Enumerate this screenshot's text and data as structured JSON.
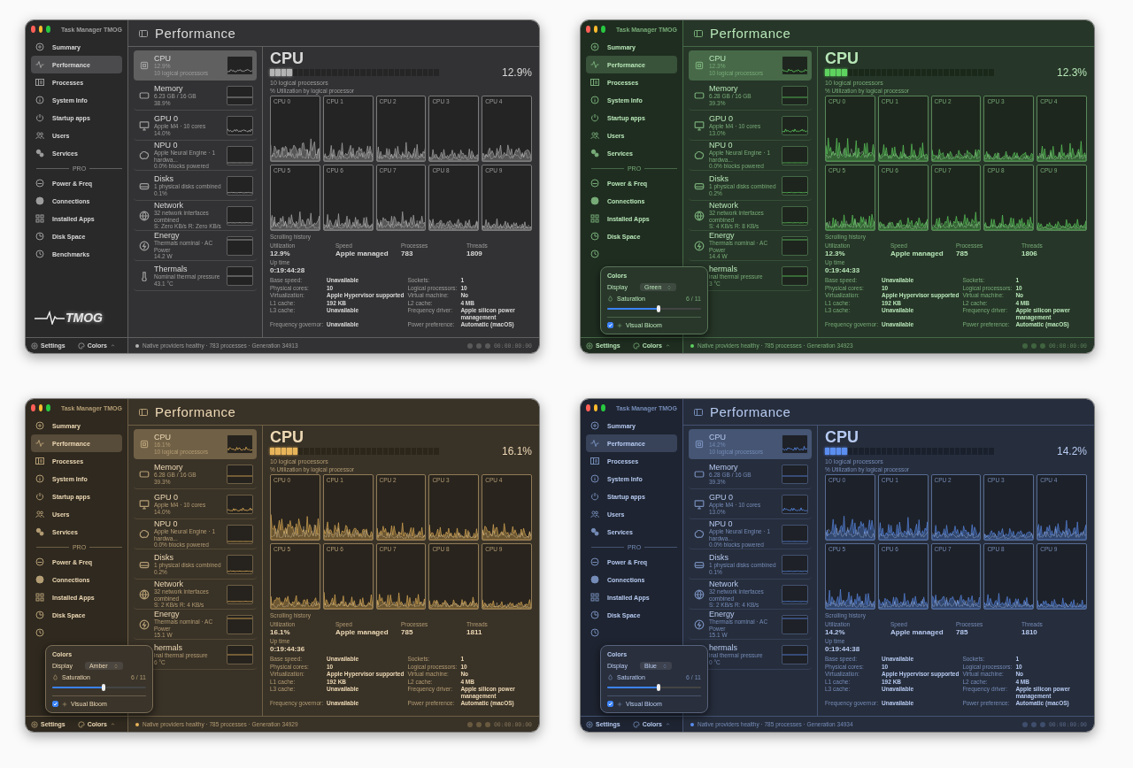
{
  "windows": [
    {
      "color": "#b4b4b4",
      "app_title": "Task Manager TMOG",
      "page_title": "Performance",
      "logo": "TMOG",
      "sidebar": {
        "items": [
          {
            "label": "Summary",
            "selected": false
          },
          {
            "label": "Performance",
            "selected": true
          },
          {
            "label": "Processes",
            "selected": false
          },
          {
            "label": "System Info",
            "selected": false
          },
          {
            "label": "Startup apps",
            "selected": false
          },
          {
            "label": "Users",
            "selected": false
          },
          {
            "label": "Services",
            "selected": false
          }
        ],
        "section_label": "PRO",
        "pro_items": [
          {
            "label": "Power & Freq",
            "selected": false
          },
          {
            "label": "Connections",
            "selected": false
          },
          {
            "label": "Installed Apps",
            "selected": false
          },
          {
            "label": "Disk Space",
            "selected": false
          },
          {
            "label": "Benchmarks",
            "selected": false
          }
        ]
      },
      "devices": [
        {
          "kind": "cpu",
          "name": "CPU",
          "line1": "12.9%",
          "line2": "10 logical processors",
          "selected": true
        },
        {
          "kind": "memory",
          "name": "Memory",
          "line1": "6.23 GB / 16 GB",
          "line2": "38.9%",
          "selected": false
        },
        {
          "kind": "gpu",
          "name": "GPU 0",
          "line1": "Apple M4 · 10 cores",
          "line2": "14.0%",
          "selected": false
        },
        {
          "kind": "npu",
          "name": "NPU 0",
          "line1": "Apple Neural Engine · 1 hardwa...",
          "line2": "0.0% blocks powered",
          "selected": false
        },
        {
          "kind": "disk",
          "name": "Disks",
          "line1": "1 physical disks combined",
          "line2": "0.1%",
          "selected": false
        },
        {
          "kind": "network",
          "name": "Network",
          "line1": "32 network interfaces combined",
          "line2": "S: Zero KB/s  R: Zero KB/s",
          "selected": false
        },
        {
          "kind": "energy",
          "name": "Energy",
          "line1": "Thermals nominal · AC Power",
          "line2": "14.2 W",
          "selected": false
        },
        {
          "kind": "thermal",
          "name": "Thermals",
          "line1": "Nominal thermal pressure",
          "line2": "43.1 °C",
          "selected": false
        }
      ],
      "detail": {
        "title": "CPU",
        "meter": {
          "level": 0.129
        },
        "reading": "12.9%",
        "subtitle": "10 logical processors",
        "caption": "% Utilization by logical processor",
        "graphs": [
          "CPU 0",
          "CPU 1",
          "CPU 2",
          "CPU 3",
          "CPU 4",
          "CPU 5",
          "CPU 6",
          "CPU 7",
          "CPU 8",
          "CPU 9"
        ],
        "history_label": "Scrolling history",
        "stats": [
          {
            "label": "Utilization",
            "value": "12.9%"
          },
          {
            "label": "Speed",
            "value": "Apple managed"
          },
          {
            "label": "Processes",
            "value": "783"
          },
          {
            "label": "Threads",
            "value": "1809"
          }
        ],
        "uptime": {
          "label": "Up time",
          "value": "0:19:44:28"
        },
        "specs": [
          {
            "label": "Base speed:",
            "value": "Unavailable"
          },
          {
            "label": "Sockets:",
            "value": "1"
          },
          {
            "label": "Physical cores:",
            "value": "10"
          },
          {
            "label": "Logical processors:",
            "value": "10"
          },
          {
            "label": "Virtualization:",
            "value": "Apple Hypervisor supported"
          },
          {
            "label": "Virtual machine:",
            "value": "No"
          },
          {
            "label": "L1 cache:",
            "value": "192 KB"
          },
          {
            "label": "L2 cache:",
            "value": "4 MB"
          },
          {
            "label": "L3 cache:",
            "value": "Unavailable"
          },
          {
            "label": "Frequency driver:",
            "value": "Apple silicon power management"
          },
          {
            "label": "Frequency governor:",
            "value": "Unavailable"
          },
          {
            "label": "Power preference:",
            "value": "Automatic (macOS)"
          }
        ]
      },
      "footer": {
        "settings": "Settings",
        "colors": "Colors",
        "status": "Native providers healthy · 783 processes · Generation 34913",
        "timer": "00:00:00:00"
      }
    },
    {
      "color": "#5fd35f",
      "app_title": "Task Manager TMOG",
      "page_title": "Performance",
      "sidebar": {
        "items": [
          {
            "label": "Summary",
            "selected": false
          },
          {
            "label": "Performance",
            "selected": true
          },
          {
            "label": "Processes",
            "selected": false
          },
          {
            "label": "System Info",
            "selected": false
          },
          {
            "label": "Startup apps",
            "selected": false
          },
          {
            "label": "Users",
            "selected": false
          },
          {
            "label": "Services",
            "selected": false
          }
        ],
        "section_label": "PRO",
        "pro_items": [
          {
            "label": "Power & Freq",
            "selected": false
          },
          {
            "label": "Connections",
            "selected": false
          },
          {
            "label": "Installed Apps",
            "selected": false
          },
          {
            "label": "Disk Space",
            "selected": false
          },
          {
            "selected": false
          }
        ]
      },
      "devices": [
        {
          "kind": "cpu",
          "name": "CPU",
          "line1": "12.3%",
          "line2": "10 logical processors",
          "selected": true
        },
        {
          "kind": "memory",
          "name": "Memory",
          "line1": "6.28 GB / 16 GB",
          "line2": "39.3%",
          "selected": false
        },
        {
          "kind": "gpu",
          "name": "GPU 0",
          "line1": "Apple M4 · 10 cores",
          "line2": "13.0%",
          "selected": false
        },
        {
          "kind": "npu",
          "name": "NPU 0",
          "line1": "Apple Neural Engine · 1 hardwa...",
          "line2": "0.0% blocks powered",
          "selected": false
        },
        {
          "kind": "disk",
          "name": "Disks",
          "line1": "1 physical disks combined",
          "line2": "0.2%",
          "selected": false
        },
        {
          "kind": "network",
          "name": "Network",
          "line1": "32 network interfaces combined",
          "line2": "S: 4 KB/s  R: 8 KB/s",
          "selected": false
        },
        {
          "kind": "energy",
          "name": "Energy",
          "line1": "Thermals nominal · AC Power",
          "line2": "14.4 W",
          "selected": false
        },
        {
          "name": "hermals",
          "line1": "inal thermal pressure",
          "line2": "3 °C",
          "selected": false
        }
      ],
      "detail": {
        "title": "CPU",
        "meter": {
          "level": 0.123
        },
        "reading": "12.3%",
        "subtitle": "10 logical processors",
        "caption": "% Utilization by logical processor",
        "graphs": [
          "CPU 0",
          "CPU 1",
          "CPU 2",
          "CPU 3",
          "CPU 4",
          "CPU 5",
          "CPU 6",
          "CPU 7",
          "CPU 8",
          "CPU 9"
        ],
        "history_label": "Scrolling history",
        "stats": [
          {
            "label": "Utilization",
            "value": "12.3%"
          },
          {
            "label": "Speed",
            "value": "Apple managed"
          },
          {
            "label": "Processes",
            "value": "785"
          },
          {
            "label": "Threads",
            "value": "1806"
          }
        ],
        "uptime": {
          "label": "Up time",
          "value": "0:19:44:33"
        },
        "specs": [
          {
            "label": "Base speed:",
            "value": "Unavailable"
          },
          {
            "label": "Sockets:",
            "value": "1"
          },
          {
            "label": "Physical cores:",
            "value": "10"
          },
          {
            "label": "Logical processors:",
            "value": "10"
          },
          {
            "label": "Virtualization:",
            "value": "Apple Hypervisor supported"
          },
          {
            "label": "Virtual machine:",
            "value": "No"
          },
          {
            "label": "L1 cache:",
            "value": "192 KB"
          },
          {
            "label": "L2 cache:",
            "value": "4 MB"
          },
          {
            "label": "L3 cache:",
            "value": "Unavailable"
          },
          {
            "label": "Frequency driver:",
            "value": "Apple silicon power management"
          },
          {
            "label": "Frequency governor:",
            "value": "Unavailable"
          },
          {
            "label": "Power preference:",
            "value": "Automatic (macOS)"
          }
        ]
      },
      "popover": {
        "title": "Colors",
        "display_label": "Display",
        "display_value": "Green",
        "saturation_label": "Saturation",
        "saturation_reading": "6 / 11",
        "level": 0.545,
        "bloom_label": "Visual Bloom",
        "bloom_checked": true
      },
      "footer": {
        "settings": "Settings",
        "colors": "Colors",
        "status": "Native providers healthy · 785 processes · Generation 34923",
        "timer": "00:00:00:00"
      }
    },
    {
      "color": "#e8b45a",
      "app_title": "Task Manager TMOG",
      "page_title": "Performance",
      "sidebar": {
        "items": [
          {
            "label": "Summary",
            "selected": false
          },
          {
            "label": "Performance",
            "selected": true
          },
          {
            "label": "Processes",
            "selected": false
          },
          {
            "label": "System Info",
            "selected": false
          },
          {
            "label": "Startup apps",
            "selected": false
          },
          {
            "label": "Users",
            "selected": false
          },
          {
            "label": "Services",
            "selected": false
          }
        ],
        "section_label": "PRO",
        "pro_items": [
          {
            "label": "Power & Freq",
            "selected": false
          },
          {
            "label": "Connections",
            "selected": false
          },
          {
            "label": "Installed Apps",
            "selected": false
          },
          {
            "label": "Disk Space",
            "selected": false
          },
          {
            "selected": false
          }
        ]
      },
      "devices": [
        {
          "kind": "cpu",
          "name": "CPU",
          "line1": "16.1%",
          "line2": "10 logical processors",
          "selected": true
        },
        {
          "kind": "memory",
          "name": "Memory",
          "line1": "6.28 GB / 16 GB",
          "line2": "39.3%",
          "selected": false
        },
        {
          "kind": "gpu",
          "name": "GPU 0",
          "line1": "Apple M4 · 10 cores",
          "line2": "14.0%",
          "selected": false
        },
        {
          "kind": "npu",
          "name": "NPU 0",
          "line1": "Apple Neural Engine · 1 hardwa...",
          "line2": "0.0% blocks powered",
          "selected": false
        },
        {
          "kind": "disk",
          "name": "Disks",
          "line1": "1 physical disks combined",
          "line2": "0.2%",
          "selected": false
        },
        {
          "kind": "network",
          "name": "Network",
          "line1": "32 network interfaces combined",
          "line2": "S: 2 KB/s  R: 4 KB/s",
          "selected": false
        },
        {
          "kind": "energy",
          "name": "Energy",
          "line1": "Thermals nominal · AC Power",
          "line2": "15.1 W",
          "selected": false
        },
        {
          "name": "hermals",
          "line1": "inal thermal pressure",
          "line2": "6 °C",
          "selected": false
        }
      ],
      "detail": {
        "title": "CPU",
        "meter": {
          "level": 0.161
        },
        "reading": "16.1%",
        "subtitle": "10 logical processors",
        "caption": "% Utilization by logical processor",
        "graphs": [
          "CPU 0",
          "CPU 1",
          "CPU 2",
          "CPU 3",
          "CPU 4",
          "CPU 5",
          "CPU 6",
          "CPU 7",
          "CPU 8",
          "CPU 9"
        ],
        "history_label": "Scrolling history",
        "stats": [
          {
            "label": "Utilization",
            "value": "16.1%"
          },
          {
            "label": "Speed",
            "value": "Apple managed"
          },
          {
            "label": "Processes",
            "value": "785"
          },
          {
            "label": "Threads",
            "value": "1811"
          }
        ],
        "uptime": {
          "label": "Up time",
          "value": "0:19:44:36"
        },
        "specs": [
          {
            "label": "Base speed:",
            "value": "Unavailable"
          },
          {
            "label": "Sockets:",
            "value": "1"
          },
          {
            "label": "Physical cores:",
            "value": "10"
          },
          {
            "label": "Logical processors:",
            "value": "10"
          },
          {
            "label": "Virtualization:",
            "value": "Apple Hypervisor supported"
          },
          {
            "label": "Virtual machine:",
            "value": "No"
          },
          {
            "label": "L1 cache:",
            "value": "192 KB"
          },
          {
            "label": "L2 cache:",
            "value": "4 MB"
          },
          {
            "label": "L3 cache:",
            "value": "Unavailable"
          },
          {
            "label": "Frequency driver:",
            "value": "Apple silicon power management"
          },
          {
            "label": "Frequency governor:",
            "value": "Unavailable"
          },
          {
            "label": "Power preference:",
            "value": "Automatic (macOS)"
          }
        ]
      },
      "popover": {
        "title": "Colors",
        "display_label": "Display",
        "display_value": "Amber",
        "saturation_label": "Saturation",
        "saturation_reading": "6 / 11",
        "level": 0.545,
        "bloom_label": "Visual Bloom",
        "bloom_checked": true
      },
      "footer": {
        "settings": "Settings",
        "colors": "Colors",
        "status": "Native providers healthy · 785 processes · Generation 34929",
        "timer": "00:00:00:00"
      }
    },
    {
      "color": "#5b8ef0",
      "app_title": "Task Manager TMOG",
      "page_title": "Performance",
      "sidebar": {
        "items": [
          {
            "label": "Summary",
            "selected": false
          },
          {
            "label": "Performance",
            "selected": true
          },
          {
            "label": "Processes",
            "selected": false
          },
          {
            "label": "System Info",
            "selected": false
          },
          {
            "label": "Startup apps",
            "selected": false
          },
          {
            "label": "Users",
            "selected": false
          },
          {
            "label": "Services",
            "selected": false
          }
        ],
        "section_label": "PRO",
        "pro_items": [
          {
            "label": "Power & Freq",
            "selected": false
          },
          {
            "label": "Connections",
            "selected": false
          },
          {
            "label": "Installed Apps",
            "selected": false
          },
          {
            "label": "Disk Space",
            "selected": false
          },
          {
            "selected": false
          }
        ]
      },
      "devices": [
        {
          "kind": "cpu",
          "name": "CPU",
          "line1": "14.2%",
          "line2": "10 logical processors",
          "selected": true
        },
        {
          "kind": "memory",
          "name": "Memory",
          "line1": "6.28 GB / 16 GB",
          "line2": "39.3%",
          "selected": false
        },
        {
          "kind": "gpu",
          "name": "GPU 0",
          "line1": "Apple M4 · 10 cores",
          "line2": "13.0%",
          "selected": false
        },
        {
          "kind": "npu",
          "name": "NPU 0",
          "line1": "Apple Neural Engine · 1 hardwa...",
          "line2": "0.0% blocks powered",
          "selected": false
        },
        {
          "kind": "disk",
          "name": "Disks",
          "line1": "1 physical disks combined",
          "line2": "0.1%",
          "selected": false
        },
        {
          "kind": "network",
          "name": "Network",
          "line1": "32 network interfaces combined",
          "line2": "S: 2 KB/s  R: 4 KB/s",
          "selected": false
        },
        {
          "kind": "energy",
          "name": "Energy",
          "line1": "Thermals nominal · AC Power",
          "line2": "15.1 W",
          "selected": false
        },
        {
          "name": "hermals",
          "line1": "inal thermal pressure",
          "line2": "0 °C",
          "selected": false
        }
      ],
      "detail": {
        "title": "CPU",
        "meter": {
          "level": 0.142
        },
        "reading": "14.2%",
        "subtitle": "10 logical processors",
        "caption": "% Utilization by logical processor",
        "graphs": [
          "CPU 0",
          "CPU 1",
          "CPU 2",
          "CPU 3",
          "CPU 4",
          "CPU 5",
          "CPU 6",
          "CPU 7",
          "CPU 8",
          "CPU 9"
        ],
        "history_label": "Scrolling history",
        "stats": [
          {
            "label": "Utilization",
            "value": "14.2%"
          },
          {
            "label": "Speed",
            "value": "Apple managed"
          },
          {
            "label": "Processes",
            "value": "785"
          },
          {
            "label": "Threads",
            "value": "1810"
          }
        ],
        "uptime": {
          "label": "Up time",
          "value": "0:19:44:38"
        },
        "specs": [
          {
            "label": "Base speed:",
            "value": "Unavailable"
          },
          {
            "label": "Sockets:",
            "value": "1"
          },
          {
            "label": "Physical cores:",
            "value": "10"
          },
          {
            "label": "Logical processors:",
            "value": "10"
          },
          {
            "label": "Virtualization:",
            "value": "Apple Hypervisor supported"
          },
          {
            "label": "Virtual machine:",
            "value": "No"
          },
          {
            "label": "L1 cache:",
            "value": "192 KB"
          },
          {
            "label": "L2 cache:",
            "value": "4 MB"
          },
          {
            "label": "L3 cache:",
            "value": "Unavailable"
          },
          {
            "label": "Frequency driver:",
            "value": "Apple silicon power management"
          },
          {
            "label": "Frequency governor:",
            "value": "Unavailable"
          },
          {
            "label": "Power preference:",
            "value": "Automatic (macOS)"
          }
        ]
      },
      "popover": {
        "title": "Colors",
        "display_label": "Display",
        "display_value": "Blue",
        "saturation_label": "Saturation",
        "saturation_reading": "6 / 11",
        "level": 0.545,
        "bloom_label": "Visual Bloom",
        "bloom_checked": true
      },
      "footer": {
        "settings": "Settings",
        "colors": "Colors",
        "status": "Native providers healthy · 785 processes · Generation 34934",
        "timer": "00:00:00:00"
      }
    }
  ]
}
